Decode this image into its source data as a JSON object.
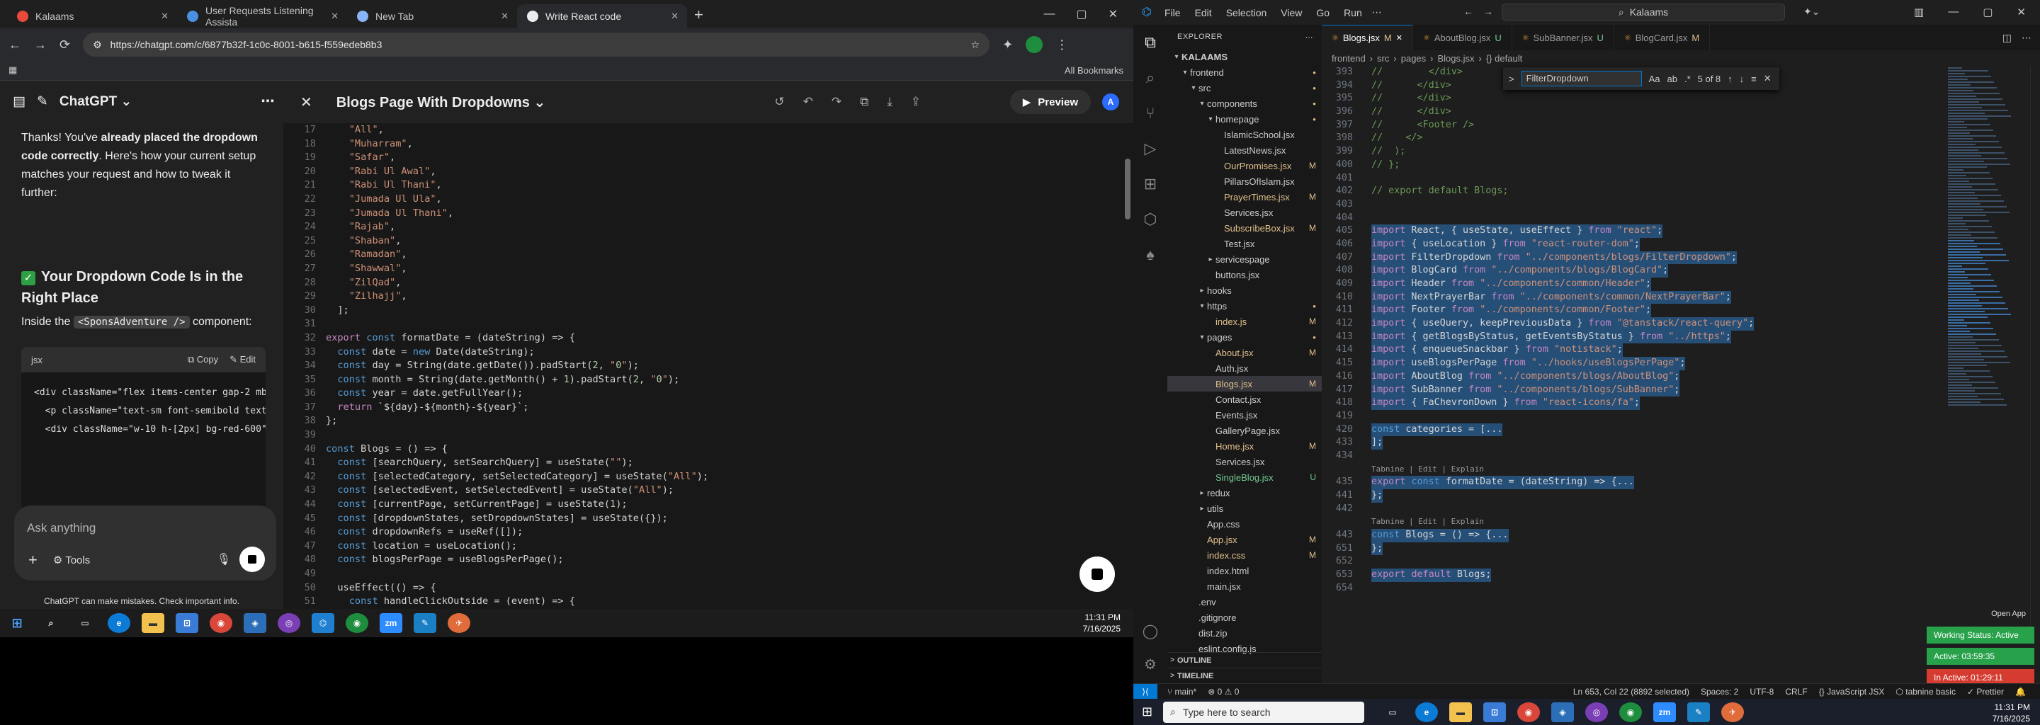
{
  "chrome": {
    "tabs": [
      {
        "title": "Kalaams",
        "color": "#e84b3c",
        "active": false
      },
      {
        "title": "User Requests Listening Assista",
        "color": "#4a90e2",
        "active": false
      },
      {
        "title": "New Tab",
        "color": "#8ab4f8",
        "active": false
      },
      {
        "title": "Write React code",
        "color": "#ececec",
        "active": true
      }
    ],
    "url": "https://chatgpt.com/c/6877b32f-1c0c-8001-b615-f559edeb8b3",
    "bookmarks_label": "All Bookmarks"
  },
  "chat": {
    "app_name": "ChatGPT",
    "intro_prefix": "Thanks! You've ",
    "intro_bold": "already placed the dropdown code correctly",
    "intro_suffix": ". Here's how your current setup matches your request and how to tweak it further:",
    "heading": "Your Dropdown Code Is in the Right Place",
    "inside_label": "Inside the",
    "inside_code": "<SponsAdventure />",
    "inside_suffix": "component:",
    "code_lang": "jsx",
    "copy_label": "Copy",
    "edit_label": "Edit",
    "code_lines": [
      "<div className=\"flex items-center gap-2 mb",
      "  <p className=\"text-sm font-semibold text",
      "  <div className=\"w-10 h-[2px] bg-red-600\""
    ],
    "ask_placeholder": "Ask anything",
    "tools_label": "Tools",
    "disclaimer": "ChatGPT can make mistakes. Check important info."
  },
  "canvas": {
    "title": "Blogs Page With Dropdowns",
    "preview_label": "Preview",
    "avatar_letter": "A",
    "lines": [
      [
        "17",
        "    \"All\","
      ],
      [
        "18",
        "    \"Muharram\","
      ],
      [
        "19",
        "    \"Safar\","
      ],
      [
        "20",
        "    \"Rabi Ul Awal\","
      ],
      [
        "21",
        "    \"Rabi Ul Thani\","
      ],
      [
        "22",
        "    \"Jumada Ul Ula\","
      ],
      [
        "23",
        "    \"Jumada Ul Thani\","
      ],
      [
        "24",
        "    \"Rajab\","
      ],
      [
        "25",
        "    \"Shaban\","
      ],
      [
        "26",
        "    \"Ramadan\","
      ],
      [
        "27",
        "    \"Shawwal\","
      ],
      [
        "28",
        "    \"ZilQad\","
      ],
      [
        "29",
        "    \"Zilhajj\","
      ],
      [
        "30",
        "  ];"
      ],
      [
        "31",
        ""
      ],
      [
        "32",
        "export const formatDate = (dateString) => {"
      ],
      [
        "33",
        "  const date = new Date(dateString);"
      ],
      [
        "34",
        "  const day = String(date.getDate()).padStart(2, \"0\");"
      ],
      [
        "35",
        "  const month = String(date.getMonth() + 1).padStart(2, \"0\");"
      ],
      [
        "36",
        "  const year = date.getFullYear();"
      ],
      [
        "37",
        "  return `${day}-${month}-${year}`;"
      ],
      [
        "38",
        "};"
      ],
      [
        "39",
        ""
      ],
      [
        "40",
        "const Blogs = () => {"
      ],
      [
        "41",
        "  const [searchQuery, setSearchQuery] = useState(\"\");"
      ],
      [
        "42",
        "  const [selectedCategory, setSelectedCategory] = useState(\"All\");"
      ],
      [
        "43",
        "  const [selectedEvent, setSelectedEvent] = useState(\"All\");"
      ],
      [
        "44",
        "  const [currentPage, setCurrentPage] = useState(1);"
      ],
      [
        "45",
        "  const [dropdownStates, setDropdownStates] = useState({});"
      ],
      [
        "46",
        "  const dropdownRefs = useRef([]);"
      ],
      [
        "47",
        "  const location = useLocation();"
      ],
      [
        "48",
        "  const blogsPerPage = useBlogsPerPage();"
      ],
      [
        "49",
        ""
      ],
      [
        "50",
        "  useEffect(() => {"
      ],
      [
        "51",
        "    const handleClickOutside = (event) => {"
      ]
    ]
  },
  "taskbar_left": {
    "time": "11:31 PM",
    "date": "7/16/2025"
  },
  "vscode": {
    "menu": [
      "File",
      "Edit",
      "Selection",
      "View",
      "Go",
      "Run"
    ],
    "search": "Kalaams",
    "explorer_label": "EXPLORER",
    "tree": [
      {
        "label": "KALAAMS",
        "depth": 0,
        "arrow": "v",
        "bold": true
      },
      {
        "label": "frontend",
        "depth": 1,
        "arrow": "v",
        "dot": "M"
      },
      {
        "label": "src",
        "depth": 2,
        "arrow": "v",
        "dot": "M"
      },
      {
        "label": "components",
        "depth": 3,
        "arrow": "v",
        "dot": "M"
      },
      {
        "label": "homepage",
        "depth": 4,
        "arrow": "v",
        "dot": "M"
      },
      {
        "label": "IslamicSchool.jsx",
        "depth": 5
      },
      {
        "label": "LatestNews.jsx",
        "depth": 5
      },
      {
        "label": "OurPromises.jsx",
        "depth": 5,
        "status": "M"
      },
      {
        "label": "PillarsOfIslam.jsx",
        "depth": 5
      },
      {
        "label": "PrayerTimes.jsx",
        "depth": 5,
        "status": "M"
      },
      {
        "label": "Services.jsx",
        "depth": 5
      },
      {
        "label": "SubscribeBox.jsx",
        "depth": 5,
        "status": "M"
      },
      {
        "label": "Test.jsx",
        "depth": 5
      },
      {
        "label": "servicespage",
        "depth": 4,
        "arrow": ">"
      },
      {
        "label": "buttons.jsx",
        "depth": 4
      },
      {
        "label": "hooks",
        "depth": 3,
        "arrow": ">"
      },
      {
        "label": "https",
        "depth": 3,
        "arrow": "v",
        "dot": "M"
      },
      {
        "label": "index.js",
        "depth": 4,
        "status": "M"
      },
      {
        "label": "pages",
        "depth": 3,
        "arrow": "v",
        "dot": "M"
      },
      {
        "label": "About.jsx",
        "depth": 4,
        "status": "M"
      },
      {
        "label": "Auth.jsx",
        "depth": 4
      },
      {
        "label": "Blogs.jsx",
        "depth": 4,
        "status": "M",
        "selected": true
      },
      {
        "label": "Contact.jsx",
        "depth": 4
      },
      {
        "label": "Events.jsx",
        "depth": 4
      },
      {
        "label": "GalleryPage.jsx",
        "depth": 4
      },
      {
        "label": "Home.jsx",
        "depth": 4,
        "status": "M"
      },
      {
        "label": "Services.jsx",
        "depth": 4
      },
      {
        "label": "SingleBlog.jsx",
        "depth": 4,
        "status": "U"
      },
      {
        "label": "redux",
        "depth": 3,
        "arrow": ">"
      },
      {
        "label": "utils",
        "depth": 3,
        "arrow": ">"
      },
      {
        "label": "App.css",
        "depth": 3
      },
      {
        "label": "App.jsx",
        "depth": 3,
        "status": "M"
      },
      {
        "label": "index.css",
        "depth": 3,
        "status": "M"
      },
      {
        "label": "index.html",
        "depth": 3
      },
      {
        "label": "main.jsx",
        "depth": 3
      },
      {
        "label": ".env",
        "depth": 2
      },
      {
        "label": ".gitignore",
        "depth": 2
      },
      {
        "label": "dist.zip",
        "depth": 2
      },
      {
        "label": "eslint.config.js",
        "depth": 2
      }
    ],
    "outline_label": "OUTLINE",
    "timeline_label": "TIMELINE",
    "tabs": [
      {
        "label": "Blogs.jsx",
        "status": "M",
        "active": true
      },
      {
        "label": "AboutBlog.jsx",
        "status": "U"
      },
      {
        "label": "SubBanner.jsx",
        "status": "U"
      },
      {
        "label": "BlogCard.jsx",
        "status": "M"
      }
    ],
    "breadcrumb": [
      "frontend",
      "src",
      "pages",
      "Blogs.jsx",
      "{} default"
    ],
    "find": {
      "query": "FilterDropdown",
      "count": "5 of 8"
    },
    "lines": [
      {
        "n": "393",
        "t": "//        </div>"
      },
      {
        "n": "394",
        "t": "//      </div>"
      },
      {
        "n": "395",
        "t": "//      </div>"
      },
      {
        "n": "396",
        "t": "//      </div>"
      },
      {
        "n": "397",
        "t": "//      <Footer />"
      },
      {
        "n": "398",
        "t": "//    </>"
      },
      {
        "n": "399",
        "t": "//  );"
      },
      {
        "n": "400",
        "t": "// };"
      },
      {
        "n": "401",
        "t": ""
      },
      {
        "n": "402",
        "t": "// export default Blogs;"
      },
      {
        "n": "403",
        "t": ""
      },
      {
        "n": "404",
        "t": ""
      },
      {
        "n": "405",
        "t": "import React, { useState, useEffect } from \"react\";",
        "hl": true
      },
      {
        "n": "406",
        "t": "import { useLocation } from \"react-router-dom\";",
        "hl": true
      },
      {
        "n": "407",
        "t": "import FilterDropdown from \"../components/blogs/FilterDropdown\";",
        "hl": true
      },
      {
        "n": "408",
        "t": "import BlogCard from \"../components/blogs/BlogCard\";",
        "hl": true
      },
      {
        "n": "409",
        "t": "import Header from \"../components/common/Header\";",
        "hl": true
      },
      {
        "n": "410",
        "t": "import NextPrayerBar from \"../components/common/NextPrayerBar\";",
        "hl": true
      },
      {
        "n": "411",
        "t": "import Footer from \"../components/common/Footer\";",
        "hl": true
      },
      {
        "n": "412",
        "t": "import { useQuery, keepPreviousData } from \"@tanstack/react-query\";",
        "hl": true
      },
      {
        "n": "413",
        "t": "import { getBlogsByStatus, getEventsByStatus } from \"../https\";",
        "hl": true
      },
      {
        "n": "414",
        "t": "import { enqueueSnackbar } from \"notistack\";",
        "hl": true
      },
      {
        "n": "415",
        "t": "import useBlogsPerPage from \"../hooks/useBlogsPerPage\";",
        "hl": true
      },
      {
        "n": "416",
        "t": "import AboutBlog from \"../components/blogs/AboutBlog\";",
        "hl": true
      },
      {
        "n": "417",
        "t": "import SubBanner from \"../components/blogs/SubBanner\";",
        "hl": true
      },
      {
        "n": "418",
        "t": "import { FaChevronDown } from \"react-icons/fa\";",
        "hl": true
      },
      {
        "n": "419",
        "t": ""
      },
      {
        "n": "420",
        "t": "const categories = [...",
        "hl": true
      },
      {
        "n": "433",
        "t": "];",
        "hl": true
      },
      {
        "n": "434",
        "t": ""
      },
      {
        "lens": "Tabnine | Edit | Explain"
      },
      {
        "n": "435",
        "t": "export const formatDate = (dateString) => {...",
        "hl": true
      },
      {
        "n": "441",
        "t": "};",
        "hl": true
      },
      {
        "n": "442",
        "t": ""
      },
      {
        "lens": "Tabnine | Edit | Explain"
      },
      {
        "n": "443",
        "t": "const Blogs = () => {...",
        "hl": true
      },
      {
        "n": "651",
        "t": "};",
        "hl": true
      },
      {
        "n": "652",
        "t": ""
      },
      {
        "n": "653",
        "t": "export default Blogs;",
        "hl": true
      },
      {
        "n": "654",
        "t": ""
      }
    ],
    "status": {
      "branch": "main*",
      "problems": "0 ⚠ 0",
      "cursor": "Ln 653, Col 22 (8892 selected)",
      "spaces": "Spaces: 2",
      "encoding": "UTF-8",
      "eol": "CRLF",
      "language": "JavaScript JSX",
      "extension": "tabnine basic",
      "prettier": "Prettier"
    },
    "open_app": "Open App",
    "badges": [
      {
        "text": "Working Status: Active",
        "color": "#27a14a"
      },
      {
        "text": "Active: 03:59:35",
        "color": "#27a14a"
      },
      {
        "text": "In Active: 01:29:11",
        "color": "#d63b2f"
      }
    ]
  },
  "taskbar_right": {
    "search_placeholder": "Type here to search",
    "time": "11:31 PM",
    "date": "7/16/2025"
  }
}
